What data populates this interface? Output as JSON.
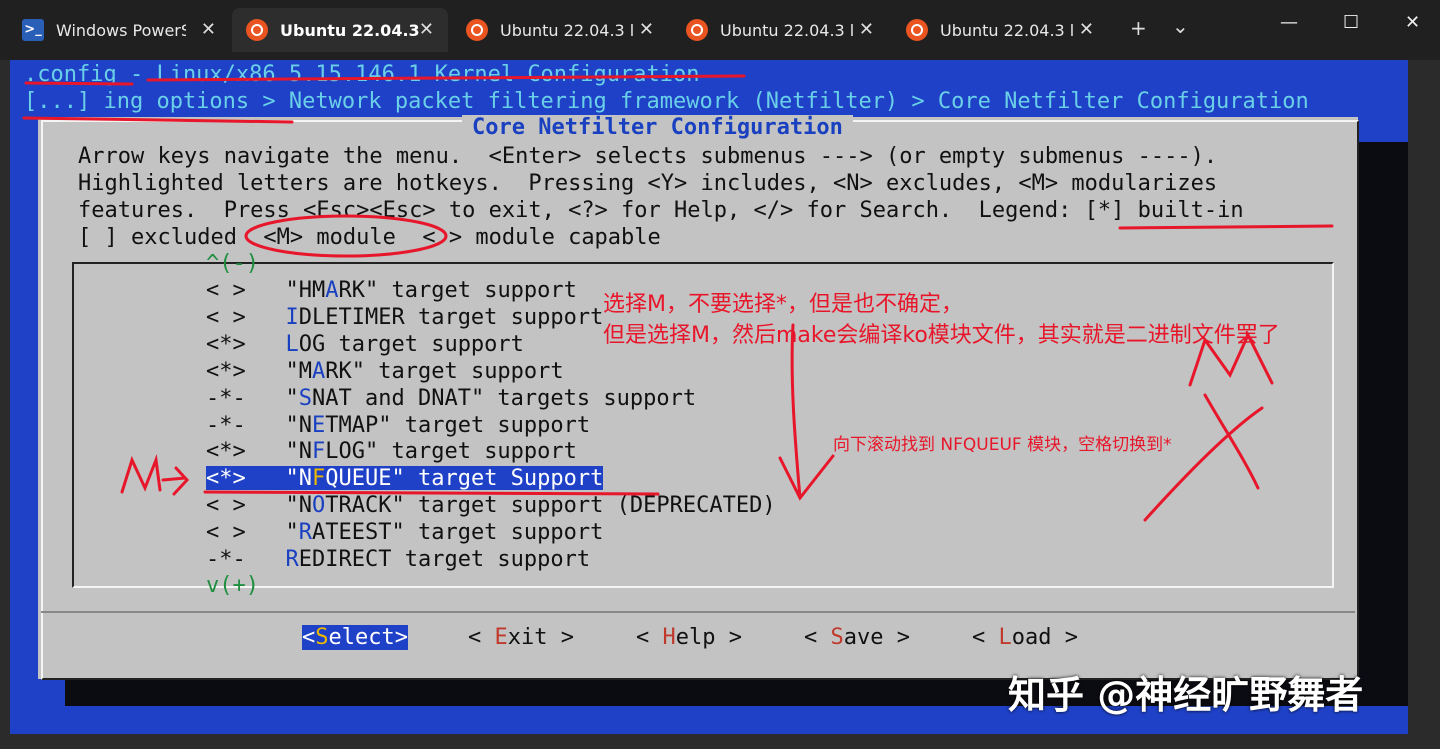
{
  "tabs": [
    {
      "label": "Windows PowerS",
      "icon": "powershell-icon",
      "close": "✕"
    },
    {
      "label": "Ubuntu 22.04.3",
      "icon": "ubuntu-icon",
      "close": "✕"
    },
    {
      "label": "Ubuntu 22.04.3 l",
      "icon": "ubuntu-icon",
      "close": "✕"
    },
    {
      "label": "Ubuntu 22.04.3 l",
      "icon": "ubuntu-icon",
      "close": "✕"
    },
    {
      "label": "Ubuntu 22.04.3 l",
      "icon": "ubuntu-icon",
      "close": "✕"
    }
  ],
  "tabbar": {
    "new_tab": "+",
    "dropdown": "⌄",
    "minimize": "—",
    "maximize": "☐",
    "close": "✕"
  },
  "terminal": {
    "title_line1": ".config - Linux/x86 5.15.146.1 Kernel Configuration",
    "title_line2": "[...] ing options > Network packet filtering framework (Netfilter) > Core Netfilter Configuration",
    "dialog_title": "Core Netfilter Configuration",
    "help_lines": [
      "Arrow keys navigate the menu.  <Enter> selects submenus ---> (or empty submenus ----).",
      "Highlighted letters are hotkeys.  Pressing <Y> includes, <N> excludes, <M> modularizes",
      "features.  Press <Esc><Esc> to exit, <?> for Help, </> for Search.  Legend: [*] built-in",
      "[ ] excluded  <M> module  < > module capable"
    ],
    "scroll_up": "^(-)",
    "scroll_down": "v(+)",
    "menu_items": [
      {
        "state": "< >",
        "pre": "\"HM",
        "hk": "A",
        "post": "RK\" target support"
      },
      {
        "state": "< >",
        "pre": "",
        "hk": "I",
        "post": "DLETIMER target support"
      },
      {
        "state": "<*>",
        "pre": "",
        "hk": "L",
        "post": "OG target support"
      },
      {
        "state": "<*>",
        "pre": "\"M",
        "hk": "A",
        "post": "RK\" target support"
      },
      {
        "state": "-*-",
        "pre": "\"",
        "hk": "S",
        "post": "NAT and DNAT\" targets support"
      },
      {
        "state": "-*-",
        "pre": "\"N",
        "hk": "E",
        "post": "TMAP\" target support"
      },
      {
        "state": "<*>",
        "pre": "\"N",
        "hk": "F",
        "post": "LOG\" target support"
      },
      {
        "state": "<*>",
        "pre": "\"N",
        "hk": "F",
        "post": "QUEUE\" target Support",
        "selected": true
      },
      {
        "state": "< >",
        "pre": "\"N",
        "hk": "O",
        "post": "TRACK\" target support (DEPRECATED)"
      },
      {
        "state": "< >",
        "pre": "\"",
        "hk": "R",
        "post": "ATEEST\" target support"
      },
      {
        "state": "-*-",
        "pre": "",
        "hk": "R",
        "post": "EDIRECT target support"
      }
    ],
    "buttons": [
      {
        "open": "<",
        "hk": "S",
        "rest": "elect",
        "close": ">",
        "selected": true
      },
      {
        "open": "< ",
        "hk": "E",
        "rest": "xit",
        "close": " >"
      },
      {
        "open": "< ",
        "hk": "H",
        "rest": "elp",
        "close": " >"
      },
      {
        "open": "< ",
        "hk": "S",
        "rest": "ave",
        "close": " >"
      },
      {
        "open": "< ",
        "hk": "L",
        "rest": "oad",
        "close": " >"
      }
    ]
  },
  "annotations": {
    "note1": "选择M，不要选择*，但是也不确定，",
    "note2": "但是选择M，然后make会编译ko模块文件，其实就是二进制文件罢了",
    "note3": "向下滚动找到 NFQUEUF 模块，空格切换到*",
    "handwritten_m": "M",
    "arrow_label": "M",
    "color": "#e8162a"
  },
  "watermark": "知乎 @神经旷野舞者"
}
